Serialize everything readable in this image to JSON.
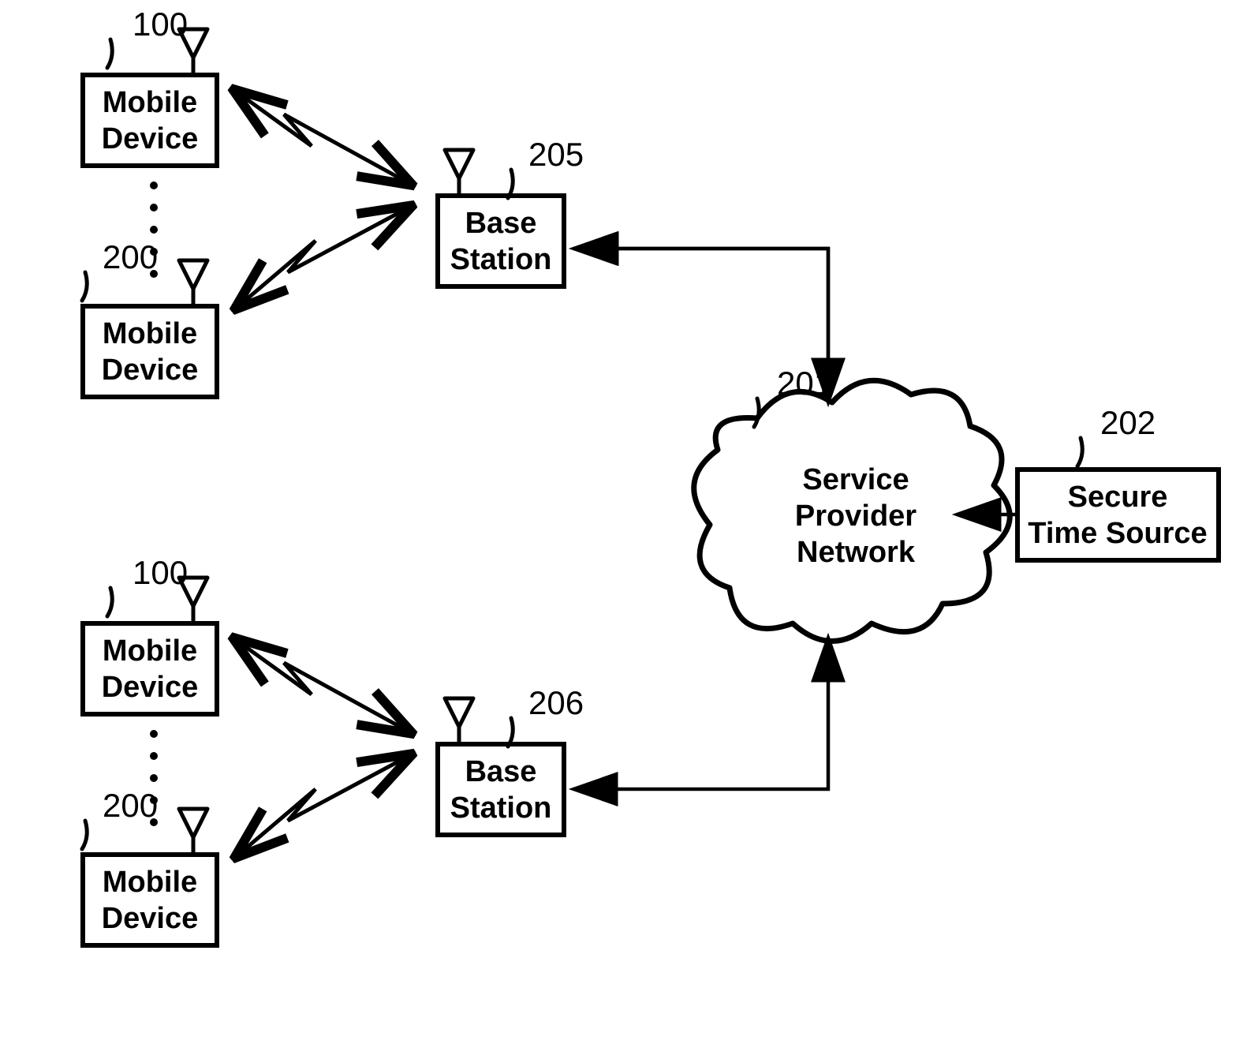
{
  "nodes": {
    "md_top_a": {
      "ref": "100",
      "line1": "Mobile",
      "line2": "Device"
    },
    "md_top_b": {
      "ref": "200",
      "line1": "Mobile",
      "line2": "Device"
    },
    "md_bot_a": {
      "ref": "100",
      "line1": "Mobile",
      "line2": "Device"
    },
    "md_bot_b": {
      "ref": "200",
      "line1": "Mobile",
      "line2": "Device"
    },
    "bs_top": {
      "ref": "205",
      "line1": "Base",
      "line2": "Station"
    },
    "bs_bot": {
      "ref": "206",
      "line1": "Base",
      "line2": "Station"
    },
    "spn": {
      "ref": "201",
      "line1": "Service",
      "line2": "Provider",
      "line3": "Network"
    },
    "sts": {
      "ref": "202",
      "line1": "Secure",
      "line2": "Time Source"
    }
  }
}
